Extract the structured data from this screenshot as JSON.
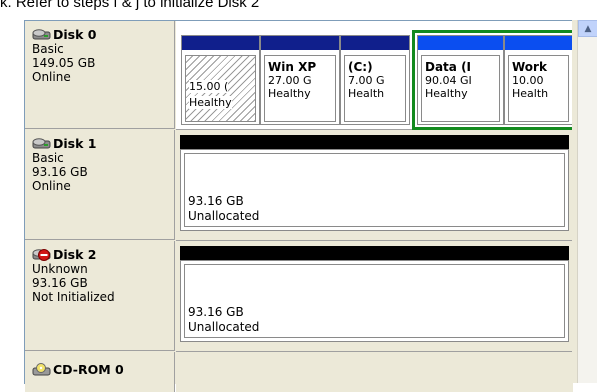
{
  "caption": "k. Refer to steps f & j to initialize Disk 2",
  "disks": [
    {
      "name": "Disk 0",
      "type": "Basic",
      "size": "149.05 GB",
      "status": "Online",
      "icon": "disk-icon",
      "partitions": [
        {
          "title": "",
          "size": "15.00 (",
          "status": "Healthy",
          "style": "hatched"
        },
        {
          "title": "Win XP",
          "size": "27.00 G",
          "status": "Healthy",
          "style": "primary"
        },
        {
          "title": "(C:)",
          "size": "7.00 G",
          "status": "Health",
          "style": "primary"
        },
        {
          "title": "Data  (I",
          "size": "90.04 GI",
          "status": "Healthy",
          "style": "primary"
        },
        {
          "title": "Work",
          "size": "10.00",
          "status": "Health",
          "style": "primary"
        }
      ]
    },
    {
      "name": "Disk 1",
      "type": "Basic",
      "size": "93.16 GB",
      "status": "Online",
      "icon": "disk-icon",
      "unallocated": {
        "size": "93.16 GB",
        "label": "Unallocated"
      }
    },
    {
      "name": "Disk 2",
      "type": "Unknown",
      "size": "93.16 GB",
      "status": "Not Initialized",
      "icon": "disk-error-icon",
      "unallocated": {
        "size": "93.16 GB",
        "label": "Unallocated"
      }
    },
    {
      "name": "CD-ROM 0",
      "icon": "cdrom-icon"
    }
  ],
  "colors": {
    "primary_header": "#101f8c",
    "highlight_header": "#0b4ef0",
    "unallocated_header": "#000000",
    "highlight_border": "#138a1e",
    "panel_bg": "#ece9d8"
  }
}
